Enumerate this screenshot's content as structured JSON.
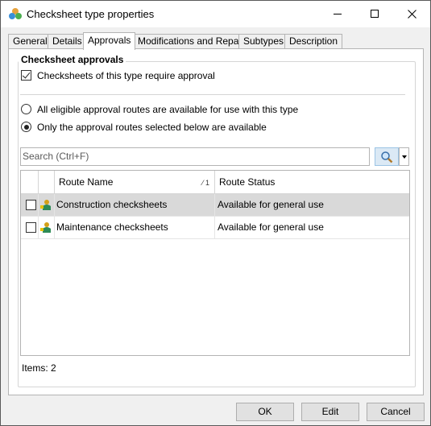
{
  "window": {
    "title": "Checksheet type properties",
    "controls": {
      "minimize": "minimize-icon",
      "maximize": "maximize-icon",
      "close": "close-icon"
    }
  },
  "tabs": [
    {
      "label": "General",
      "active": false
    },
    {
      "label": "Details",
      "active": false
    },
    {
      "label": "Approvals",
      "active": true
    },
    {
      "label": "Modifications and Repairs",
      "active": false
    },
    {
      "label": "Subtypes",
      "active": false
    },
    {
      "label": "Description",
      "active": false
    }
  ],
  "approvals": {
    "group_title": "Checksheet approvals",
    "require_approval": {
      "label": "Checksheets of this type require approval",
      "checked": true
    },
    "route_options": [
      {
        "label": "All eligible approval routes are available for use with this type",
        "selected": false
      },
      {
        "label": "Only the approval routes selected below are available",
        "selected": true
      }
    ],
    "search": {
      "placeholder": "Search    (Ctrl+F)",
      "value": ""
    },
    "grid": {
      "columns": [
        {
          "label": "Route Name",
          "sort_indicator": "1"
        },
        {
          "label": "Route Status"
        }
      ],
      "rows": [
        {
          "name": "Construction checksheets",
          "status": "Available for general use",
          "checked": false,
          "selected": true
        },
        {
          "name": "Maintenance checksheets",
          "status": "Available for general use",
          "checked": false,
          "selected": false
        }
      ]
    },
    "items_count": "Items: 2"
  },
  "buttons": {
    "ok": "OK",
    "edit": "Edit",
    "cancel": "Cancel"
  },
  "colors": {
    "selected_row": "#d9d9d9",
    "search_button": "#dbe9f5",
    "border": "#b4b4b4"
  }
}
